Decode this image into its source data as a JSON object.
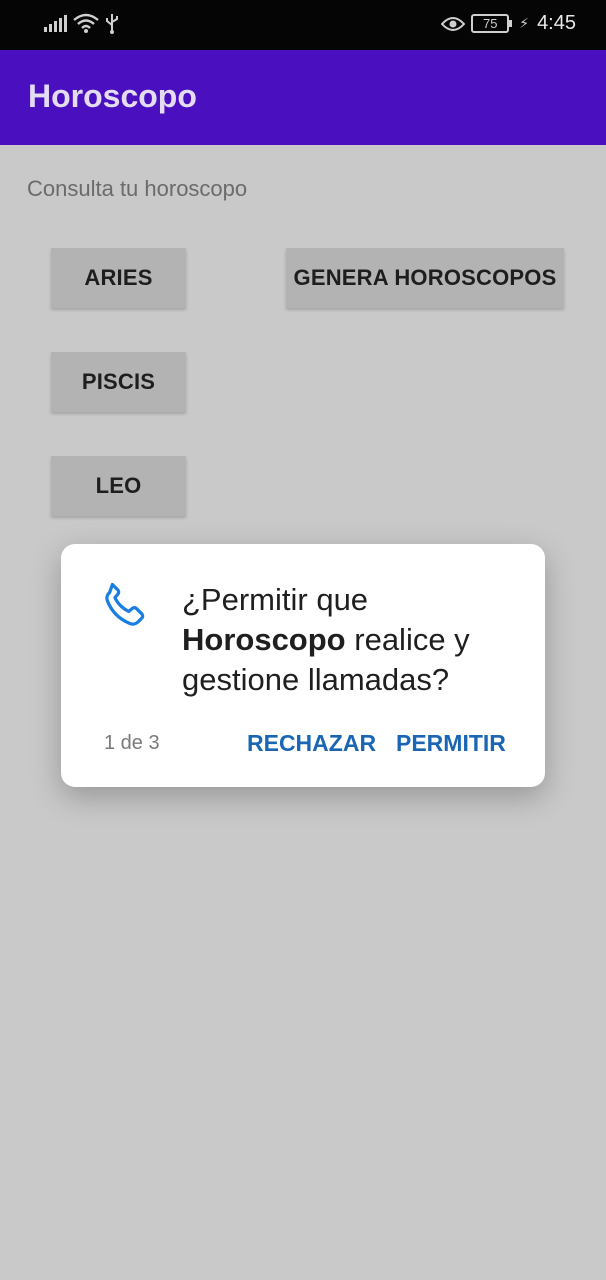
{
  "status_bar": {
    "battery_level": "75",
    "time": "4:45",
    "icons": [
      "signal-icon",
      "wifi-icon",
      "usb-icon",
      "eye-icon",
      "battery-icon",
      "charging-icon"
    ]
  },
  "app_bar": {
    "title": "Horoscopo",
    "color": "#4a0fbf"
  },
  "content": {
    "prompt": "Consulta tu horoscopo",
    "buttons": {
      "aries": "ARIES",
      "genera": "GENERA HOROSCOPOS",
      "piscis": "PISCIS",
      "leo": "LEO"
    }
  },
  "dialog": {
    "icon": "phone-icon",
    "message_prefix": "¿Permitir que",
    "app_name": "Horoscopo",
    "message_suffix": "realice y gestione llamadas?",
    "counter": "1 de 3",
    "deny_label": "RECHAZAR",
    "allow_label": "PERMITIR",
    "accent_color": "#1a66b4"
  }
}
